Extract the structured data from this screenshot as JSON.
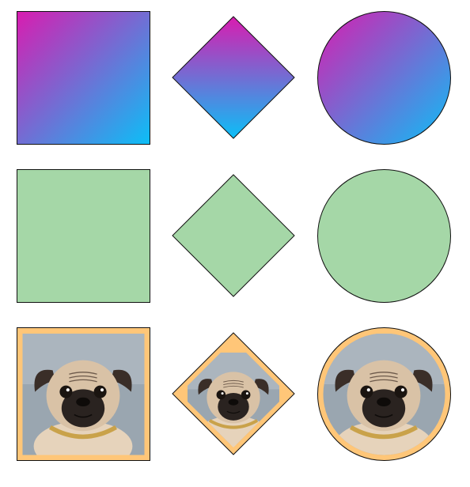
{
  "rows": [
    {
      "kind": "gradient",
      "shapes": [
        "square",
        "diamond",
        "circle"
      ],
      "gradient": {
        "start": "#d91cb0",
        "end": "#0bbff7"
      },
      "stroke": "#111111"
    },
    {
      "kind": "solid",
      "shapes": [
        "square",
        "diamond",
        "circle"
      ],
      "fill": "#a5d7a7",
      "stroke": "#111111"
    },
    {
      "kind": "photo",
      "shapes": [
        "square",
        "diamond",
        "circle"
      ],
      "frame_color": "#ffc678",
      "stroke": "#111111",
      "photo_subject": "pug-photo"
    }
  ],
  "colors": {
    "background": "#ffffff",
    "pug_fawn": "#d9c2a6",
    "pug_mask": "#2a2320",
    "pug_bg": "#9aa6b0",
    "collar": "#c9a24a"
  }
}
